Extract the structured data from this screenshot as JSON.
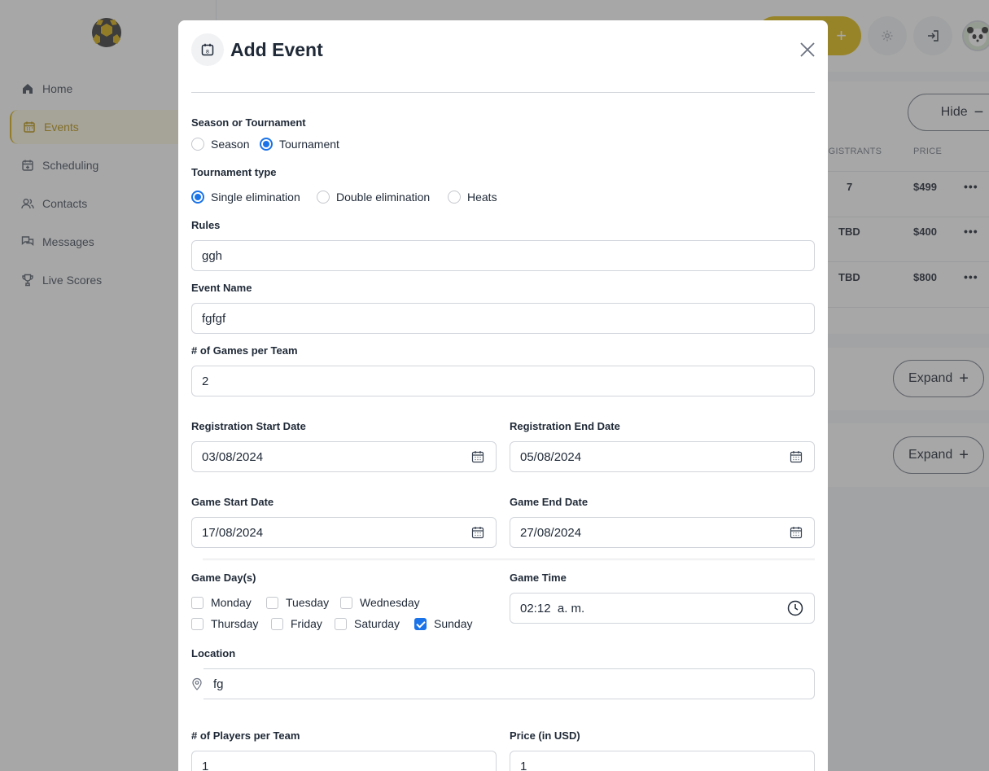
{
  "sidebar": {
    "items": [
      {
        "label": "Home",
        "icon": "home-icon"
      },
      {
        "label": "Events",
        "icon": "calendar-icon",
        "active": true
      },
      {
        "label": "Scheduling",
        "icon": "calendar-plus-icon"
      },
      {
        "label": "Contacts",
        "icon": "users-icon"
      },
      {
        "label": "Messages",
        "icon": "messages-icon"
      },
      {
        "label": "Live Scores",
        "icon": "trophy-icon"
      }
    ]
  },
  "topbar": {
    "create_icon": "+"
  },
  "events_card": {
    "hide_label": "Hide",
    "columns": [
      "EGISTRANTS",
      "PRICE"
    ],
    "rows": [
      {
        "registrants": "7",
        "price": "$499"
      },
      {
        "registrants": "TBD",
        "price": "$400"
      },
      {
        "registrants": "TBD",
        "price": "$800"
      }
    ],
    "row_menu": "•••",
    "expand_label_1": "Expand",
    "expand_label_2": "Expand"
  },
  "modal": {
    "title": "Add Event",
    "season_or_tournament": {
      "label": "Season or Tournament",
      "options": [
        "Season",
        "Tournament"
      ],
      "selected": "Tournament"
    },
    "tournament_type": {
      "label": "Tournament type",
      "options": [
        "Single elimination",
        "Double elimination",
        "Heats"
      ],
      "selected": "Single elimination"
    },
    "rules": {
      "label": "Rules",
      "value": "ggh"
    },
    "event_name": {
      "label": "Event Name",
      "value": "fgfgf"
    },
    "games_per_team": {
      "label": "# of Games per Team",
      "value": "2"
    },
    "registration_start": {
      "label": "Registration Start Date",
      "value": "03/08/2024"
    },
    "registration_end": {
      "label": "Registration End Date",
      "value": "05/08/2024"
    },
    "game_start": {
      "label": "Game Start Date",
      "value": "17/08/2024"
    },
    "game_end": {
      "label": "Game End Date",
      "value": "27/08/2024"
    },
    "game_days": {
      "label": "Game Day(s)",
      "days": [
        {
          "label": "Monday",
          "checked": false
        },
        {
          "label": "Tuesday",
          "checked": false
        },
        {
          "label": "Wednesday",
          "checked": false
        },
        {
          "label": "Thursday",
          "checked": false
        },
        {
          "label": "Friday",
          "checked": false
        },
        {
          "label": "Saturday",
          "checked": false
        },
        {
          "label": "Sunday",
          "checked": true
        }
      ]
    },
    "game_time": {
      "label": "Game Time",
      "value": "02:12  a. m."
    },
    "location": {
      "label": "Location",
      "value": "fg"
    },
    "players_per_team": {
      "label": "# of Players per Team",
      "value": "1"
    },
    "price": {
      "label": "Price (in USD)",
      "value": "1"
    }
  },
  "colors": {
    "accent": "#e0b800",
    "primary": "#1a73e8",
    "overlay": "rgba(80,80,80,0.5)"
  }
}
